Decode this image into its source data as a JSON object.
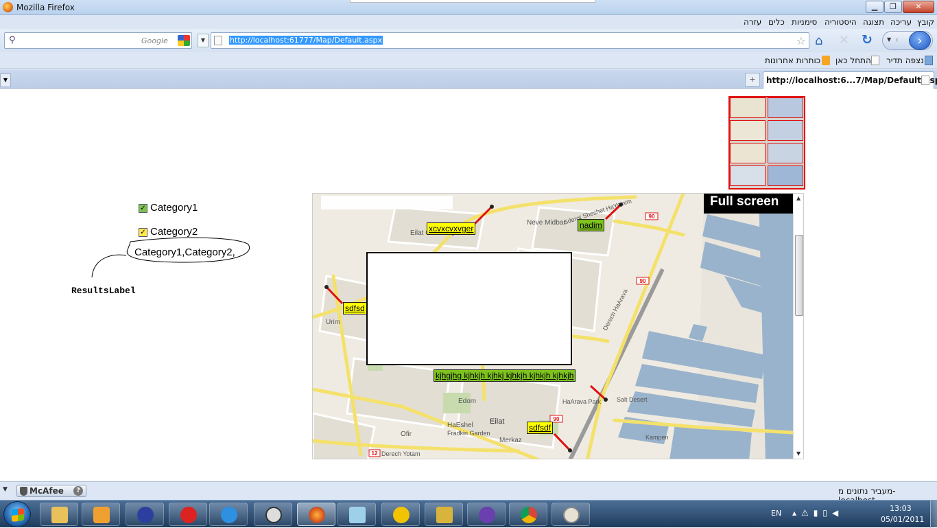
{
  "window": {
    "title": "Mozilla Firefox"
  },
  "menu": [
    "עזרה",
    "כלים",
    "סימניות",
    "היסטוריה",
    "תצוגה",
    "עריכה",
    "קובץ"
  ],
  "search": {
    "placeholder": "Google"
  },
  "address": {
    "url": "http://localhost:61777/Map/Default.aspx"
  },
  "bookmarks": [
    "כותרות אחרונות",
    "התחל כאן",
    "נצפה תדיר"
  ],
  "tab": {
    "title": "http://localhost:6...7/Map/Default.aspx"
  },
  "page": {
    "categories": [
      {
        "label": "Category1",
        "checked": true
      },
      {
        "label": "Category2",
        "checked": true
      }
    ],
    "results_text": "Category1,Category2,",
    "results_annotation": "ResultsLabel"
  },
  "map": {
    "full_screen_label": "Full screen",
    "markers": [
      {
        "label": "xcvxcvxvger",
        "color": "#ffff00"
      },
      {
        "label": "nadim",
        "color": "#7ec21e"
      },
      {
        "label": "sdfsd",
        "color": "#ffff00"
      },
      {
        "label": "kjhgjhg kjhkjh kjhkj kjhkjh kjhkjh kjhkjh",
        "color": "#7ec21e"
      },
      {
        "label": "sdfsdf",
        "color": "#ffff00"
      }
    ],
    "place_names": [
      "Eilat Cemetery",
      "Neve Midbar",
      "Urim",
      "Edom",
      "Eilat",
      "HaEshel",
      "Ofir",
      "Merkaz",
      "Fradkin Garden",
      "HaArava Park",
      "Salt Desert",
      "Derech Yotam",
      "Derech HaArava",
      "Sderot Sheshet HaYamim",
      "Kampen"
    ],
    "road_numbers": [
      "90",
      "90",
      "90",
      "12"
    ]
  },
  "status": {
    "text": "מעביר נתונים מ-localhost...",
    "addon": "McAfee"
  },
  "taskbar": {
    "lang": "EN",
    "time": "13:03",
    "date": "05/01/2011"
  }
}
